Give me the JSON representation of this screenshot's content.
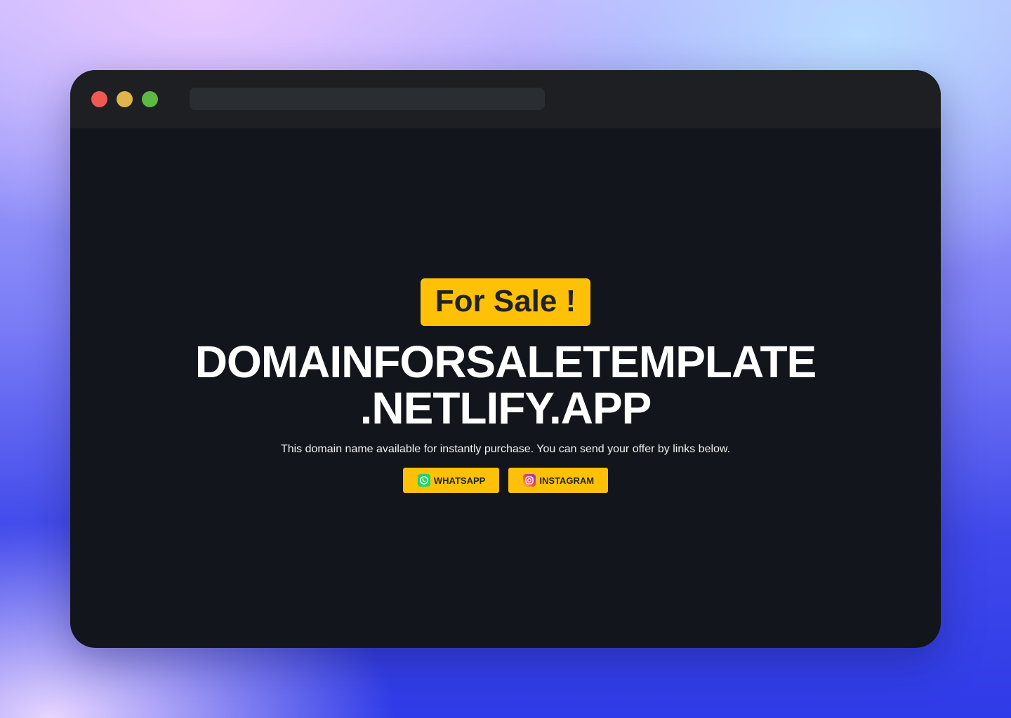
{
  "colors": {
    "window_bg": "#12151b",
    "titlebar_bg": "#1e1f23",
    "accent": "#ffc107",
    "dot_red": "#ee5a52",
    "dot_yellow": "#dfb44a",
    "dot_green": "#5cb944",
    "whatsapp": "#25d366",
    "instagram": "#d6249f"
  },
  "browser": {
    "address_text": ""
  },
  "main": {
    "badge": "For Sale !",
    "domain_line1": "DOMAINFORSALETEMPLATE",
    "domain_line2": ".NETLIFY.APP",
    "description": "This domain name available for instantly purchase. You can send your offer by links below.",
    "buttons": [
      {
        "label": "WHATSAPP",
        "icon": "whatsapp-icon"
      },
      {
        "label": "INSTAGRAM",
        "icon": "instagram-icon"
      }
    ]
  }
}
